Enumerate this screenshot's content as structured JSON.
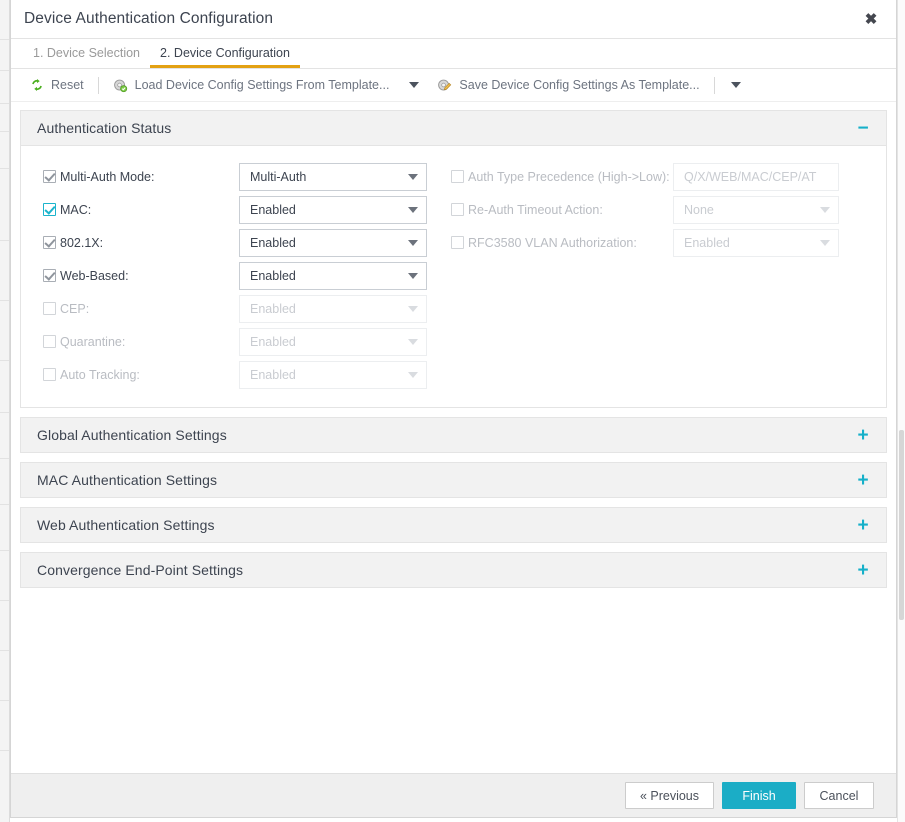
{
  "dialog": {
    "title": "Device Authentication Configuration",
    "close_label": "✖"
  },
  "tabs": [
    {
      "label": "1. Device Selection",
      "active": false
    },
    {
      "label": "2. Device Configuration",
      "active": true
    }
  ],
  "toolbar": {
    "reset_label": "Reset",
    "load_template_label": "Load Device Config Settings From Template...",
    "save_template_label": "Save Device Config Settings As Template..."
  },
  "sections": {
    "auth_status": {
      "title": "Authentication Status",
      "toggle": "−",
      "left_rows": [
        {
          "label": "Multi-Auth Mode:",
          "checked": true,
          "accent": false,
          "enabled": true,
          "control": "select",
          "value": "Multi-Auth"
        },
        {
          "label": "MAC:",
          "checked": true,
          "accent": true,
          "enabled": true,
          "control": "select",
          "value": "Enabled"
        },
        {
          "label": "802.1X:",
          "checked": true,
          "accent": false,
          "enabled": true,
          "control": "select",
          "value": "Enabled"
        },
        {
          "label": "Web-Based:",
          "checked": true,
          "accent": false,
          "enabled": true,
          "control": "select",
          "value": "Enabled"
        },
        {
          "label": "CEP:",
          "checked": false,
          "accent": false,
          "enabled": false,
          "control": "select",
          "value": "Enabled"
        },
        {
          "label": "Quarantine:",
          "checked": false,
          "accent": false,
          "enabled": false,
          "control": "select",
          "value": "Enabled"
        },
        {
          "label": "Auto Tracking:",
          "checked": false,
          "accent": false,
          "enabled": false,
          "control": "select",
          "value": "Enabled"
        }
      ],
      "right_rows": [
        {
          "label": "Auth Type Precedence (High->Low):",
          "checked": false,
          "enabled": false,
          "control": "text",
          "value": "Q/X/WEB/MAC/CEP/AT"
        },
        {
          "label": "Re-Auth Timeout Action:",
          "checked": false,
          "enabled": false,
          "control": "select",
          "value": "None"
        },
        {
          "label": "RFC3580 VLAN Authorization:",
          "checked": false,
          "enabled": false,
          "control": "select",
          "value": "Enabled"
        }
      ]
    },
    "collapsed": [
      {
        "title": "Global Authentication Settings",
        "toggle": "+"
      },
      {
        "title": "MAC Authentication Settings",
        "toggle": "+"
      },
      {
        "title": "Web Authentication Settings",
        "toggle": "+"
      },
      {
        "title": "Convergence End-Point Settings",
        "toggle": "+"
      }
    ]
  },
  "footer": {
    "previous_label": "« Previous",
    "finish_label": "Finish",
    "cancel_label": "Cancel"
  },
  "colors": {
    "accent": "#1badc6",
    "tab_underline": "#e3a113",
    "section_bg": "#f2f2f2"
  }
}
